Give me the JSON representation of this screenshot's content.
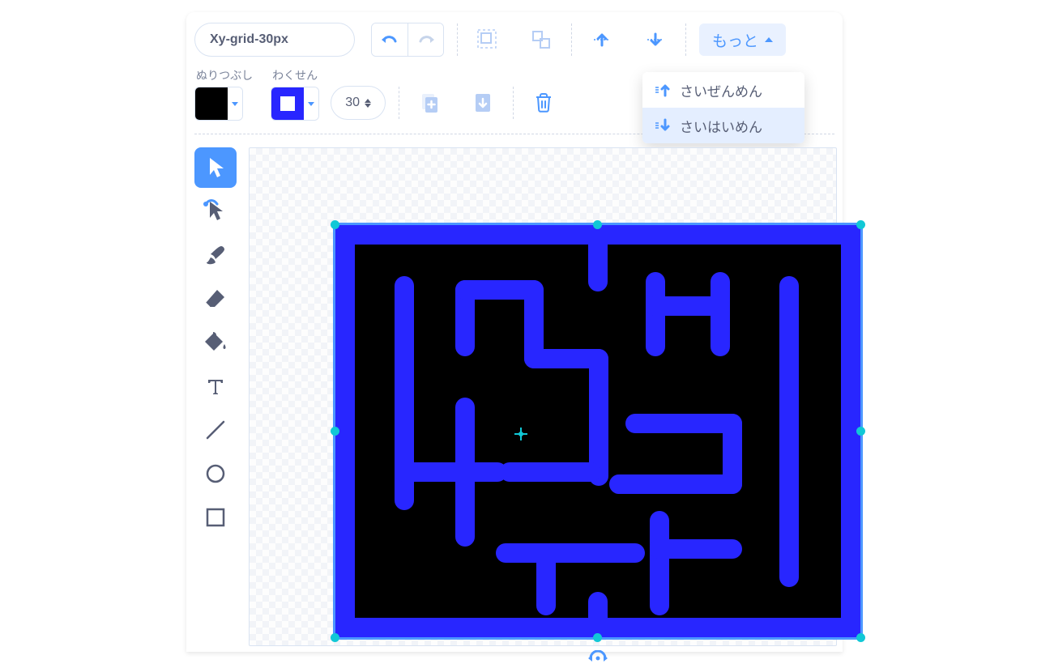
{
  "project": {
    "name": "Xy-grid-30px"
  },
  "labels": {
    "fill": "ぬりつぶし",
    "outline": "わくせん",
    "more": "もっと"
  },
  "outline_size": "30",
  "colors": {
    "fill": "#000000",
    "outline": "#2826ff",
    "accent": "#4c97ff",
    "handle": "#11c8d6"
  },
  "dropdown": {
    "items": [
      {
        "label": "さいぜんめん",
        "icon": "bring-to-front-icon"
      },
      {
        "label": "さいはいめん",
        "icon": "send-to-back-icon"
      }
    ]
  },
  "tools": [
    {
      "name": "select-tool",
      "active": true
    },
    {
      "name": "reshape-tool",
      "active": false
    },
    {
      "name": "brush-tool",
      "active": false
    },
    {
      "name": "eraser-tool",
      "active": false
    },
    {
      "name": "fill-tool",
      "active": false
    },
    {
      "name": "text-tool",
      "active": false
    },
    {
      "name": "line-tool",
      "active": false
    },
    {
      "name": "circle-tool",
      "active": false
    },
    {
      "name": "rect-tool",
      "active": false
    }
  ]
}
